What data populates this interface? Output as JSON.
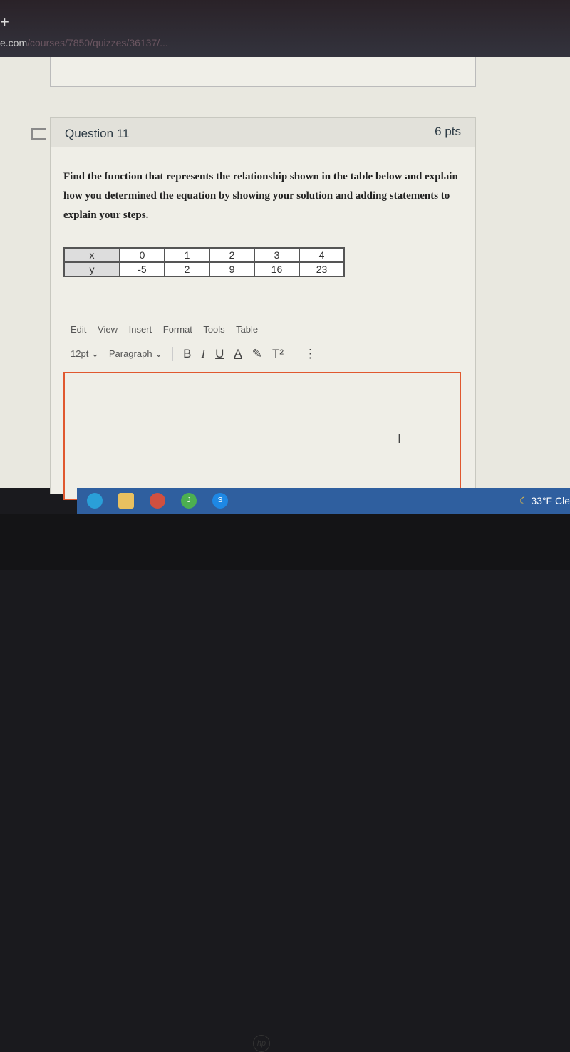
{
  "browser": {
    "url_domain": "e.com",
    "url_path": "/courses/7850/quizzes/36137/..."
  },
  "question": {
    "title": "Question 11",
    "points": "6 pts",
    "prompt": "Find the function that represents the relationship shown in the table below and explain how you determined the equation by showing your solution and adding statements to explain your steps.",
    "table": {
      "rows": [
        [
          "x",
          "0",
          "1",
          "2",
          "3",
          "4"
        ],
        [
          "y",
          "-5",
          "2",
          "9",
          "16",
          "23"
        ]
      ]
    }
  },
  "editor": {
    "menu": [
      "Edit",
      "View",
      "Insert",
      "Format",
      "Tools",
      "Table"
    ],
    "font_size": "12pt",
    "block_format": "Paragraph",
    "bold": "B",
    "italic": "I",
    "underline": "U",
    "text_color": "A",
    "superscript": "T²",
    "more": "⋮",
    "body": ""
  },
  "taskbar": {
    "icons": [
      "edge-icon",
      "file-explorer-icon",
      "snipping-tool-icon",
      "chrome-profile-j-icon",
      "chrome-profile-s-icon"
    ],
    "profile_j": "J",
    "profile_s": "S",
    "weather": "33°F Cle"
  },
  "colors": {
    "editor_border": "#e0582f",
    "taskbar": "#2f5f9f"
  }
}
